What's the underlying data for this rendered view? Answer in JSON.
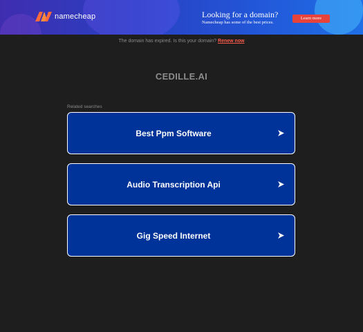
{
  "banner": {
    "logo_text": "namecheap",
    "ad_title": "Looking for a domain?",
    "ad_subtitle": "Namecheap has some of the best prices.",
    "cta_label": "Learn more"
  },
  "notice": {
    "text": "The domain has expired. Is this your domain?",
    "renew_label": "Renew now"
  },
  "domain": "CEDILLE.AI",
  "related_label": "Related searches",
  "results": [
    {
      "label": "Best Ppm Software"
    },
    {
      "label": "Audio Transcription Api"
    },
    {
      "label": "Gig Speed Internet"
    }
  ]
}
